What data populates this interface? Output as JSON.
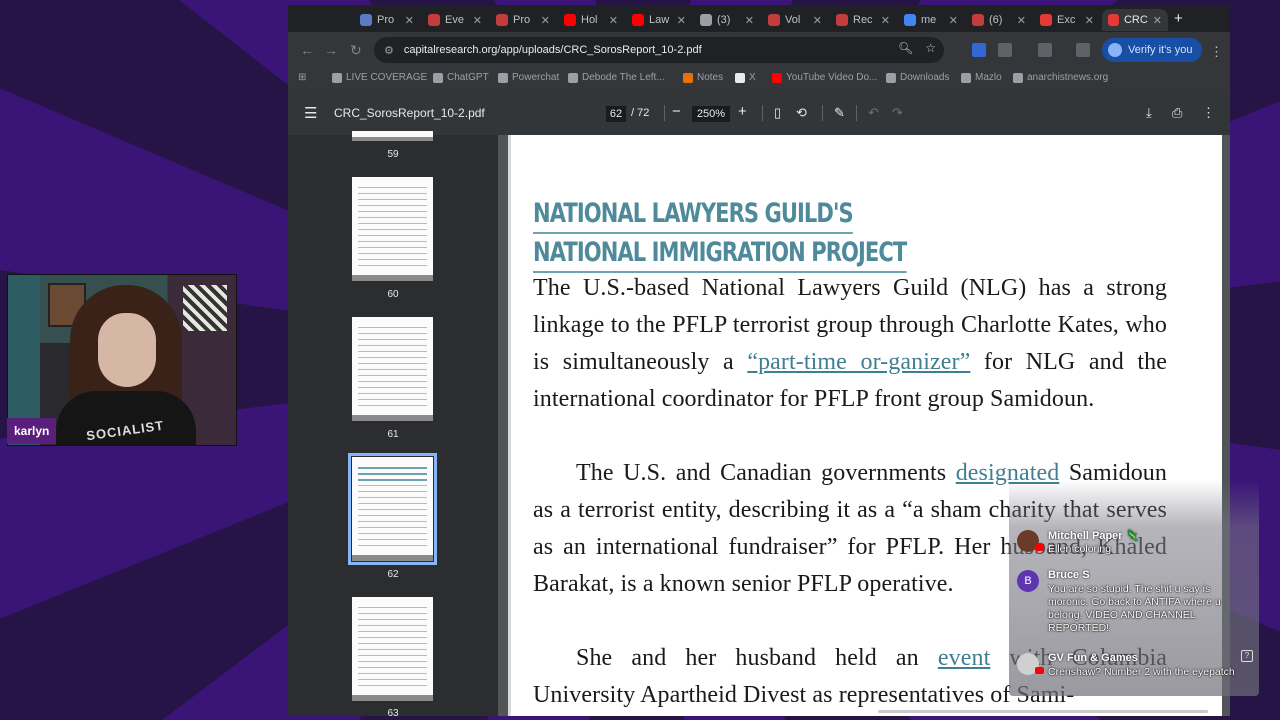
{
  "tabs": [
    {
      "label": "Pro",
      "color": "#5b7cc4"
    },
    {
      "label": "Eve",
      "color": "#c43c3c"
    },
    {
      "label": "Pro",
      "color": "#c43c3c"
    },
    {
      "label": "Hol",
      "color": "#ff0000"
    },
    {
      "label": "Law",
      "color": "#ff0000"
    },
    {
      "label": "(3)",
      "color": "#9aa0a6"
    },
    {
      "label": "Vol",
      "color": "#c43c3c"
    },
    {
      "label": "Rec",
      "color": "#c43c3c"
    },
    {
      "label": "me",
      "color": "#4285f4"
    },
    {
      "label": "(6)",
      "color": "#c43c3c"
    },
    {
      "label": "Exc",
      "color": "#e53935"
    },
    {
      "label": "CRC",
      "color": "#e53935"
    }
  ],
  "omnibox": {
    "url": "capitalresearch.org/app/uploads/CRC_SorosReport_10-2.pdf"
  },
  "profile": {
    "label": "Verify it's you"
  },
  "bookmarks": [
    "LIVE COVERAGE",
    "ChatGPT",
    "Powerchat",
    "Debode The Left...",
    "Notes",
    "X",
    "YouTube Video Do...",
    "Downloads",
    "Mazlo",
    "anarchistnews.org"
  ],
  "pdf": {
    "filename": "CRC_SorosReport_10-2.pdf",
    "current_page": "62",
    "total_pages": "/ 72",
    "zoom": "250%",
    "thumbnail_pages": [
      "59",
      "60",
      "61",
      "62",
      "63"
    ],
    "heading_line1": "NATIONAL LAWYERS GUILD'S",
    "heading_line2": "NATIONAL IMMIGRATION PROJECT",
    "p1_a": "The U.S.-based National Lawyers Guild (NLG) has a strong linkage to the PFLP terrorist group through Charlotte Kates, who is simultaneously a ",
    "p1_link": "“part-time or-ganizer”",
    "p1_b": " for NLG and the international coordinator for PFLP front group Samidoun.",
    "p2_a": "The U.S. and Canadian governments ",
    "p2_link": "designated",
    "p2_b": " Samidoun as a terrorist entity, describing it as a “a sham charity that serves as an international fundraiser” for PFLP. Her husband, Khaled Barakat, is a known senior PFLP operative.",
    "p3_a": "She and her husband held an ",
    "p3_link": "event",
    "p3_b": " with Columbia University Apartheid Divest as representatives of Sami-"
  },
  "webcam": {
    "name": "karlyn",
    "shirt_text": "SOCIALIST"
  },
  "chat": [
    {
      "name": "Mitchell Paper 🦎",
      "text": "Ellen coloring",
      "avatar_color": "#6b3b2a"
    },
    {
      "name": "Bruce S",
      "text": "You are so stupid. The shit u say is moronic. Go back to ANTIFA where u belong. VIDEO AND CHANNEL REPORTED!",
      "avatar_color": "#5e35b1",
      "initial": "B"
    },
    {
      "name": "GV Fun & Games",
      "text": "Crenshaw? Number 2 with the eyepatch",
      "avatar_color": "#d0d0d0"
    }
  ]
}
